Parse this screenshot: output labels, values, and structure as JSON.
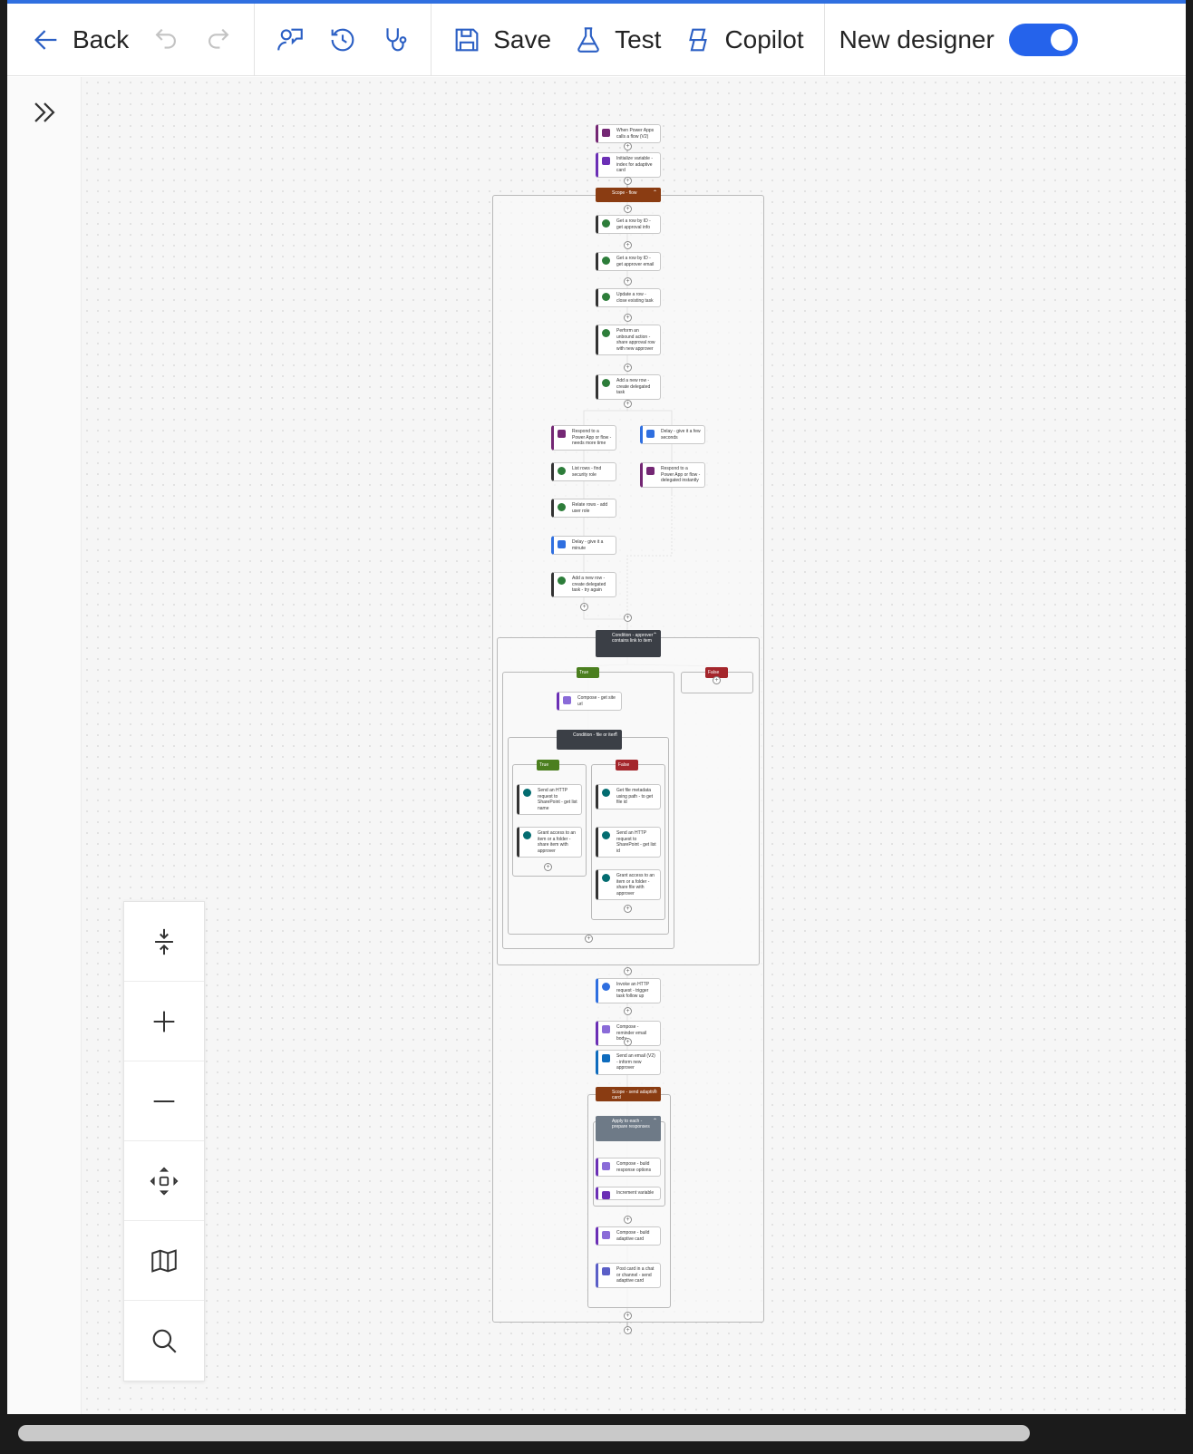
{
  "toolbar": {
    "back_label": "Back",
    "save_label": "Save",
    "test_label": "Test",
    "copilot_label": "Copilot",
    "new_designer_label": "New designer",
    "new_designer_on": true
  },
  "flow": {
    "trigger": "When Power Apps calls a flow (V2)",
    "init_var": "Initialize variable - index for adaptive card",
    "scope_flow": "Scope - flow",
    "get_row_1": "Get a row by ID - get approval info",
    "get_row_2": "Get a row by ID - get approver email",
    "update_row": "Update a row - close existing task",
    "unbound": "Perform an unbound action - share approval row with new approver",
    "add_row": "Add a new row - create delegated task",
    "respond_1": "Respond to a Power App or flow - needs more time",
    "list_rows": "List rows - find security role",
    "relate_rows": "Relate rows - add user role",
    "delay_min": "Delay - give it a minute",
    "add_row_retry": "Add a new row - create delegated task - try again",
    "delay_sec": "Delay - give it a few seconds",
    "respond_2": "Respond to a Power App or flow - delegated instantly",
    "cond_1": "Condition - approver contains link to item",
    "true_label": "True",
    "false_label": "False",
    "compose_site": "Compose - get site url",
    "cond_2": "Condition - file or item",
    "http_list": "Send an HTTP request to SharePoint - get list name",
    "grant_item": "Grant access to an item or a folder - share item with approver",
    "file_meta": "Get file metadata using path - to get file id",
    "http_list_id": "Send an HTTP request to SharePoint - get list id",
    "grant_file": "Grant access to an item or a folder - share file with approver",
    "invoke_http": "Invoke an HTTP request - trigger task follow up",
    "compose_reminder": "Compose - reminder email body",
    "send_email": "Send an email (V2) - inform new approver",
    "scope_card": "Scope - send adaptive card",
    "apply_each": "Apply to each - prepare responses",
    "compose_options": "Compose - build response options",
    "increment": "Increment variable",
    "compose_card": "Compose - build adaptive card",
    "post_card": "Post card in a chat or channel - send adaptive card"
  },
  "colors": {
    "accent": "#2563eb",
    "scope": "#8a3c12",
    "condition": "#3b3f46",
    "true": "#4b7f1f",
    "false": "#a4262c",
    "dataverse": "#2d7d3a",
    "powerapps": "#742774",
    "variable": "#6b2fb5"
  },
  "icons": [
    "arrow-left-icon",
    "undo-icon",
    "redo-icon",
    "feedback-icon",
    "history-icon",
    "stethoscope-icon",
    "save-icon",
    "flask-icon",
    "copilot-icon",
    "chevron-double-right-icon",
    "fit-view-icon",
    "zoom-in-icon",
    "zoom-out-icon",
    "center-icon",
    "minimap-icon",
    "search-icon"
  ]
}
